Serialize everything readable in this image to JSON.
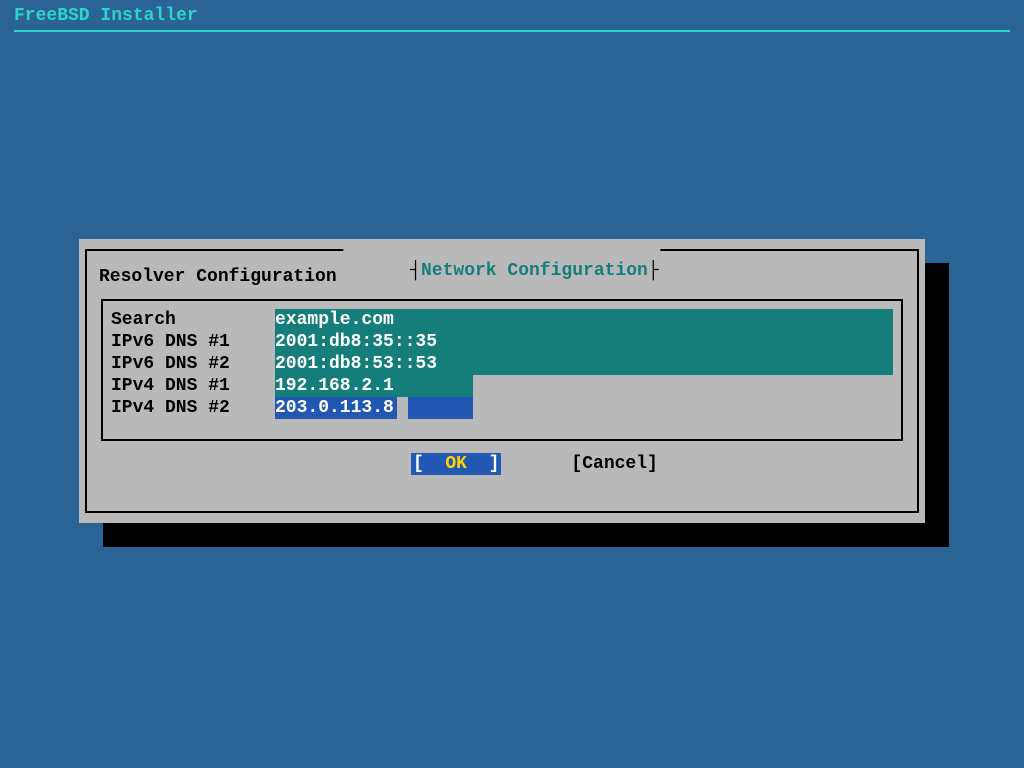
{
  "header": {
    "title": "FreeBSD Installer"
  },
  "dialog": {
    "title": "Network Configuration",
    "subtitle": "Resolver Configuration",
    "rows": [
      {
        "label": "Search",
        "value": "example.com"
      },
      {
        "label": "IPv6 DNS #1",
        "value": "2001:db8:35::35"
      },
      {
        "label": "IPv6 DNS #2",
        "value": "2001:db8:53::53"
      },
      {
        "label": "IPv4 DNS #1",
        "value": "192.168.2.1"
      },
      {
        "label": "IPv4 DNS #2",
        "value": "203.0.113.8"
      }
    ],
    "buttons": {
      "ok": {
        "text": "  OK  ",
        "open": "[",
        "close": "]"
      },
      "cancel": {
        "text": "Cancel",
        "open": "[",
        "close": "]"
      }
    },
    "active_row_index": 4
  }
}
